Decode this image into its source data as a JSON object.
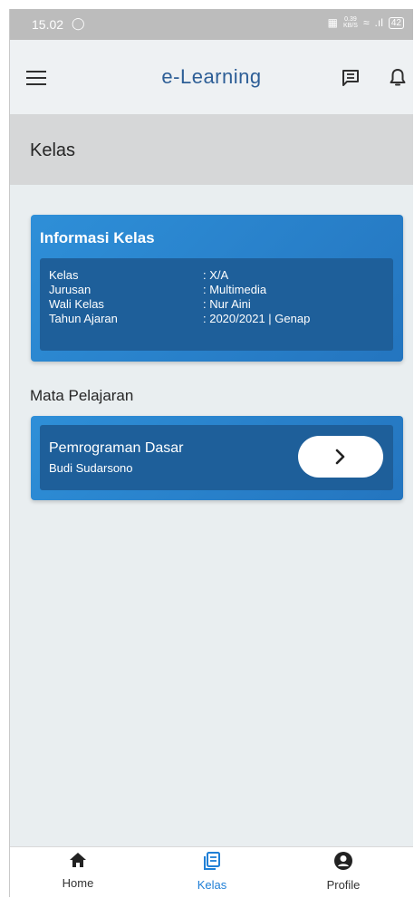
{
  "status_bar": {
    "time": "15.02",
    "net_speed_value": "0.39",
    "net_speed_unit": "KB/S",
    "battery": "42"
  },
  "app_bar": {
    "title": "e-Learning",
    "menu_icon": "hamburger-menu-icon",
    "chat_icon": "chat-icon",
    "notification_icon": "bell-icon"
  },
  "page": {
    "title": "Kelas"
  },
  "class_info": {
    "title": "Informasi Kelas",
    "rows": [
      {
        "label": "Kelas",
        "value": ": X/A"
      },
      {
        "label": "Jurusan",
        "value": ": Multimedia"
      },
      {
        "label": "Wali Kelas",
        "value": ": Nur Aini"
      },
      {
        "label": "Tahun Ajaran",
        "value": ": 2020/2021 | Genap"
      }
    ]
  },
  "subjects": {
    "title": "Mata Pelajaran",
    "items": [
      {
        "name": "Pemrograman Dasar",
        "teacher": "Budi Sudarsono",
        "action_icon": "chevron-right-icon"
      }
    ]
  },
  "bottom_nav": {
    "items": [
      {
        "label": "Home",
        "icon": "home-icon"
      },
      {
        "label": "Kelas",
        "icon": "book-icon",
        "active": true
      },
      {
        "label": "Profile",
        "icon": "user-icon"
      }
    ]
  },
  "colors": {
    "accent": "#2e8fd8",
    "panel": "#1e5f9a",
    "title": "#2d5e96",
    "active_nav": "#1f7fd6"
  }
}
